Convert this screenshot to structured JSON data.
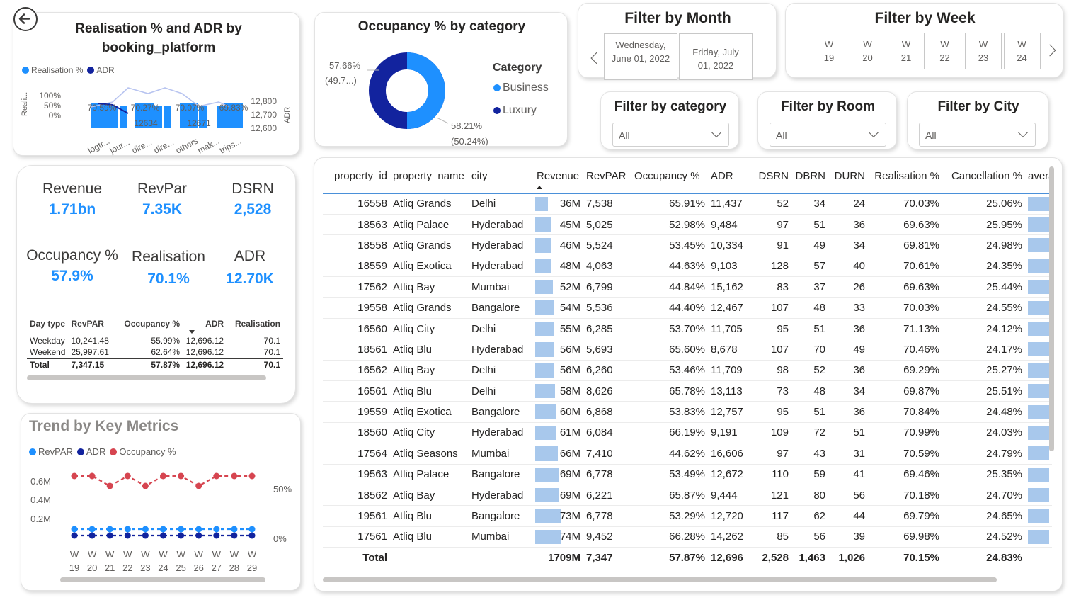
{
  "realisation_chart": {
    "title": "Realisation % and ADR by booking_platform",
    "legend": [
      {
        "name": "Realisation %",
        "color": "#1e90ff"
      },
      {
        "name": "ADR",
        "color": "#12239e"
      }
    ],
    "left_axis_label": "Reali...",
    "left_ticks": [
      "100%",
      "50%",
      "0%"
    ],
    "right_axis_label": "ADR",
    "right_ticks": [
      "12,800",
      "12,700",
      "12,600"
    ],
    "bar_labels": [
      "70.59%",
      "70.27%",
      "70.07%",
      "69.83%"
    ],
    "line_labels": [
      "12634",
      "12671"
    ],
    "categories": [
      "logtr...",
      "jour...",
      "dire...",
      "dire...",
      "others",
      "mak...",
      "trips..."
    ]
  },
  "occupancy_donut": {
    "title": "Occupancy % by category",
    "legend_title": "Category",
    "label_business": "58.21%",
    "label_business_sub": "(50.24%)",
    "label_luxury": "57.66%",
    "label_luxury_sub": "(49.7...)"
  },
  "filters": {
    "month": {
      "title": "Filter by Month",
      "tiles": [
        "Wednesday, June 01, 2022",
        "Friday, July 01, 2022"
      ]
    },
    "week": {
      "title": "Filter by Week",
      "tiles": [
        {
          "w": "W",
          "n": "19"
        },
        {
          "w": "W",
          "n": "20"
        },
        {
          "w": "W",
          "n": "21"
        },
        {
          "w": "W",
          "n": "22"
        },
        {
          "w": "W",
          "n": "23"
        },
        {
          "w": "W",
          "n": "24"
        }
      ]
    },
    "category": {
      "title": "Filter by category",
      "value": "All"
    },
    "room": {
      "title": "Filter by Room",
      "value": "All"
    },
    "city": {
      "title": "Filter by City",
      "value": "All"
    }
  },
  "kpis": {
    "revenue": {
      "label": "Revenue",
      "value": "1.71bn"
    },
    "revpar": {
      "label": "RevPar",
      "value": "7.35K"
    },
    "dsrn": {
      "label": "DSRN",
      "value": "2,528"
    },
    "occupancy": {
      "label": "Occupancy %",
      "value": "57.9%"
    },
    "realisation": {
      "label": "Realisation",
      "value": "70.1%"
    },
    "adr": {
      "label": "ADR",
      "value": "12.70K"
    }
  },
  "daytype_table": {
    "headers": [
      "Day type",
      "RevPAR",
      "Occupancy %",
      "ADR",
      "Realisation"
    ],
    "rows": [
      [
        "Weekday",
        "10,241.48",
        "55.99%",
        "12,696.12",
        "70.1"
      ],
      [
        "Weekend",
        "25,997.61",
        "62.64%",
        "12,696.12",
        "70.1"
      ]
    ],
    "total": [
      "Total",
      "7,347.15",
      "57.87%",
      "12,696.12",
      "70.1"
    ]
  },
  "trend_chart": {
    "title": "Trend by Key Metrics",
    "legend": [
      {
        "name": "RevPAR",
        "color": "#1e90ff"
      },
      {
        "name": "ADR",
        "color": "#12239e"
      },
      {
        "name": "Occupancy %",
        "color": "#d64550"
      }
    ],
    "left_ticks": [
      "0.6M",
      "0.4M",
      "0.2M"
    ],
    "right_ticks": [
      "50%",
      "0%"
    ],
    "weeks": [
      {
        "w": "W",
        "n": "19"
      },
      {
        "w": "W",
        "n": "20"
      },
      {
        "w": "W",
        "n": "21"
      },
      {
        "w": "W",
        "n": "22"
      },
      {
        "w": "W",
        "n": "23"
      },
      {
        "w": "W",
        "n": "24"
      },
      {
        "w": "W",
        "n": "25"
      },
      {
        "w": "W",
        "n": "26"
      },
      {
        "w": "W",
        "n": "27"
      },
      {
        "w": "W",
        "n": "28"
      },
      {
        "w": "W",
        "n": "29"
      }
    ]
  },
  "main_table": {
    "headers": [
      "property_id",
      "property_name",
      "city",
      "Revenue",
      "RevPAR",
      "Occupancy %",
      "ADR",
      "DSRN",
      "DBRN",
      "DURN",
      "Realisation %",
      "Cancellation %",
      "avera"
    ],
    "rows": [
      {
        "property_id": "16558",
        "property_name": "Atliq Grands",
        "city": "Delhi",
        "revenue": "36M",
        "revenue_value": 36,
        "revpar": "7,538",
        "occupancy": "65.91%",
        "adr": "11,437",
        "dsrn": "52",
        "dbrn": "34",
        "durn": "24",
        "realisation": "70.03%",
        "cancellation": "25.06%"
      },
      {
        "property_id": "18563",
        "property_name": "Atliq Palace",
        "city": "Hyderabad",
        "revenue": "45M",
        "revenue_value": 45,
        "revpar": "5,025",
        "occupancy": "52.98%",
        "adr": "9,484",
        "dsrn": "97",
        "dbrn": "51",
        "durn": "36",
        "realisation": "69.63%",
        "cancellation": "25.95%"
      },
      {
        "property_id": "18558",
        "property_name": "Atliq Grands",
        "city": "Hyderabad",
        "revenue": "46M",
        "revenue_value": 46,
        "revpar": "5,524",
        "occupancy": "53.45%",
        "adr": "10,334",
        "dsrn": "91",
        "dbrn": "49",
        "durn": "34",
        "realisation": "69.81%",
        "cancellation": "24.98%"
      },
      {
        "property_id": "18559",
        "property_name": "Atliq Exotica",
        "city": "Hyderabad",
        "revenue": "48M",
        "revenue_value": 48,
        "revpar": "4,063",
        "occupancy": "44.63%",
        "adr": "9,103",
        "dsrn": "128",
        "dbrn": "57",
        "durn": "40",
        "realisation": "70.61%",
        "cancellation": "24.35%"
      },
      {
        "property_id": "17562",
        "property_name": "Atliq Bay",
        "city": "Mumbai",
        "revenue": "52M",
        "revenue_value": 52,
        "revpar": "6,799",
        "occupancy": "44.84%",
        "adr": "15,162",
        "dsrn": "83",
        "dbrn": "37",
        "durn": "26",
        "realisation": "69.63%",
        "cancellation": "25.44%"
      },
      {
        "property_id": "19558",
        "property_name": "Atliq Grands",
        "city": "Bangalore",
        "revenue": "54M",
        "revenue_value": 54,
        "revpar": "5,536",
        "occupancy": "44.40%",
        "adr": "12,467",
        "dsrn": "107",
        "dbrn": "48",
        "durn": "33",
        "realisation": "70.03%",
        "cancellation": "24.55%"
      },
      {
        "property_id": "16560",
        "property_name": "Atliq City",
        "city": "Delhi",
        "revenue": "55M",
        "revenue_value": 55,
        "revpar": "6,285",
        "occupancy": "53.70%",
        "adr": "11,705",
        "dsrn": "95",
        "dbrn": "51",
        "durn": "36",
        "realisation": "71.13%",
        "cancellation": "24.12%"
      },
      {
        "property_id": "18561",
        "property_name": "Atliq Blu",
        "city": "Hyderabad",
        "revenue": "56M",
        "revenue_value": 56,
        "revpar": "5,693",
        "occupancy": "65.60%",
        "adr": "8,678",
        "dsrn": "107",
        "dbrn": "70",
        "durn": "49",
        "realisation": "70.46%",
        "cancellation": "24.17%"
      },
      {
        "property_id": "16562",
        "property_name": "Atliq Bay",
        "city": "Delhi",
        "revenue": "56M",
        "revenue_value": 56,
        "revpar": "6,260",
        "occupancy": "53.46%",
        "adr": "11,709",
        "dsrn": "98",
        "dbrn": "52",
        "durn": "36",
        "realisation": "69.29%",
        "cancellation": "25.27%"
      },
      {
        "property_id": "16561",
        "property_name": "Atliq Blu",
        "city": "Delhi",
        "revenue": "58M",
        "revenue_value": 58,
        "revpar": "8,626",
        "occupancy": "65.78%",
        "adr": "13,113",
        "dsrn": "73",
        "dbrn": "48",
        "durn": "34",
        "realisation": "69.87%",
        "cancellation": "25.51%"
      },
      {
        "property_id": "19559",
        "property_name": "Atliq Exotica",
        "city": "Bangalore",
        "revenue": "60M",
        "revenue_value": 60,
        "revpar": "6,868",
        "occupancy": "53.83%",
        "adr": "12,757",
        "dsrn": "95",
        "dbrn": "51",
        "durn": "36",
        "realisation": "70.84%",
        "cancellation": "24.48%"
      },
      {
        "property_id": "18560",
        "property_name": "Atliq City",
        "city": "Hyderabad",
        "revenue": "61M",
        "revenue_value": 61,
        "revpar": "6,084",
        "occupancy": "66.19%",
        "adr": "9,191",
        "dsrn": "109",
        "dbrn": "72",
        "durn": "51",
        "realisation": "70.99%",
        "cancellation": "24.03%"
      },
      {
        "property_id": "17564",
        "property_name": "Atliq Seasons",
        "city": "Mumbai",
        "revenue": "66M",
        "revenue_value": 66,
        "revpar": "7,410",
        "occupancy": "44.62%",
        "adr": "16,606",
        "dsrn": "97",
        "dbrn": "43",
        "durn": "31",
        "realisation": "70.59%",
        "cancellation": "24.79%"
      },
      {
        "property_id": "19563",
        "property_name": "Atliq Palace",
        "city": "Bangalore",
        "revenue": "69M",
        "revenue_value": 69,
        "revpar": "6,778",
        "occupancy": "53.49%",
        "adr": "12,672",
        "dsrn": "110",
        "dbrn": "59",
        "durn": "41",
        "realisation": "69.46%",
        "cancellation": "25.35%"
      },
      {
        "property_id": "18562",
        "property_name": "Atliq Bay",
        "city": "Hyderabad",
        "revenue": "69M",
        "revenue_value": 69,
        "revpar": "6,221",
        "occupancy": "65.87%",
        "adr": "9,444",
        "dsrn": "121",
        "dbrn": "80",
        "durn": "56",
        "realisation": "70.18%",
        "cancellation": "24.70%"
      },
      {
        "property_id": "19561",
        "property_name": "Atliq Blu",
        "city": "Bangalore",
        "revenue": "73M",
        "revenue_value": 73,
        "revpar": "6,778",
        "occupancy": "53.29%",
        "adr": "12,720",
        "dsrn": "117",
        "dbrn": "62",
        "durn": "44",
        "realisation": "69.79%",
        "cancellation": "24.65%"
      },
      {
        "property_id": "17561",
        "property_name": "Atliq Blu",
        "city": "Mumbai",
        "revenue": "74M",
        "revenue_value": 74,
        "revpar": "9,452",
        "occupancy": "66.28%",
        "adr": "14,262",
        "dsrn": "85",
        "dbrn": "56",
        "durn": "39",
        "realisation": "69.98%",
        "cancellation": "24.52%"
      }
    ],
    "total": {
      "label": "Total",
      "revenue": "1709M",
      "revpar": "7,347",
      "occupancy": "57.87%",
      "adr": "12,696",
      "dsrn": "2,528",
      "dbrn": "1,463",
      "durn": "1,026",
      "realisation": "70.15%",
      "cancellation": "24.83%"
    }
  }
}
